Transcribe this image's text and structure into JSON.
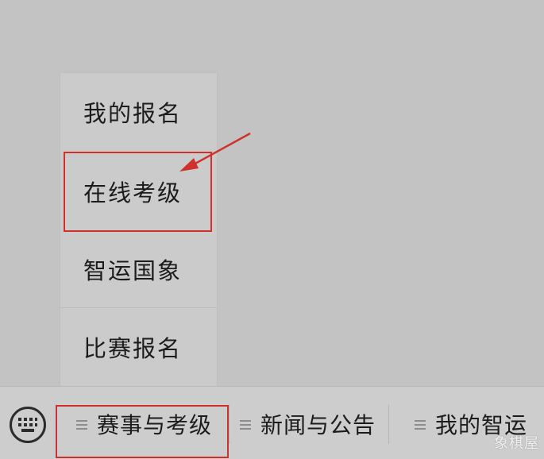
{
  "menu": {
    "items": [
      {
        "label": "我的报名"
      },
      {
        "label": "在线考级"
      },
      {
        "label": "智运国象"
      },
      {
        "label": "比赛报名"
      }
    ]
  },
  "bottom_bar": {
    "keyboard_icon": "keyboard-icon",
    "tabs": [
      {
        "label": "赛事与考级",
        "icon": "menu-lines-icon"
      },
      {
        "label": "新闻与公告",
        "icon": "menu-lines-icon"
      },
      {
        "label": "我的智运",
        "icon": "menu-lines-icon"
      }
    ]
  },
  "annotation": {
    "color": "#d0312d"
  },
  "watermark": {
    "text": "象棋屋"
  }
}
